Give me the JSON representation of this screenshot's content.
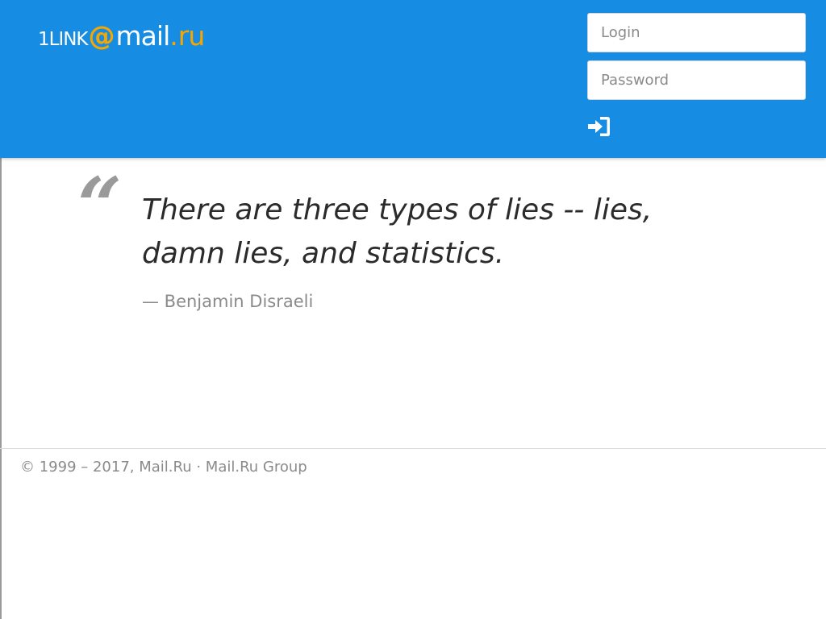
{
  "header": {
    "logo": {
      "prefix": "1LINK",
      "at": "@",
      "mail": "mail",
      "dot": ".",
      "ru": "ru"
    },
    "login_placeholder": "Login",
    "password_placeholder": "Password",
    "signin_icon": "sign-in-icon"
  },
  "quote": {
    "mark": "“",
    "text": "There are three types of lies -- lies, damn lies, and statistics.",
    "author": "— Benjamin Disraeli"
  },
  "footer": {
    "copyright": "© 1999 – 2017, ",
    "link_mailru": "Mail.Ru",
    "separator": " · ",
    "link_group": "Mail.Ru Group"
  },
  "colors": {
    "header_bg": "#168de2",
    "brand_accent": "#f7a600",
    "muted_text": "#8a8a8a"
  }
}
